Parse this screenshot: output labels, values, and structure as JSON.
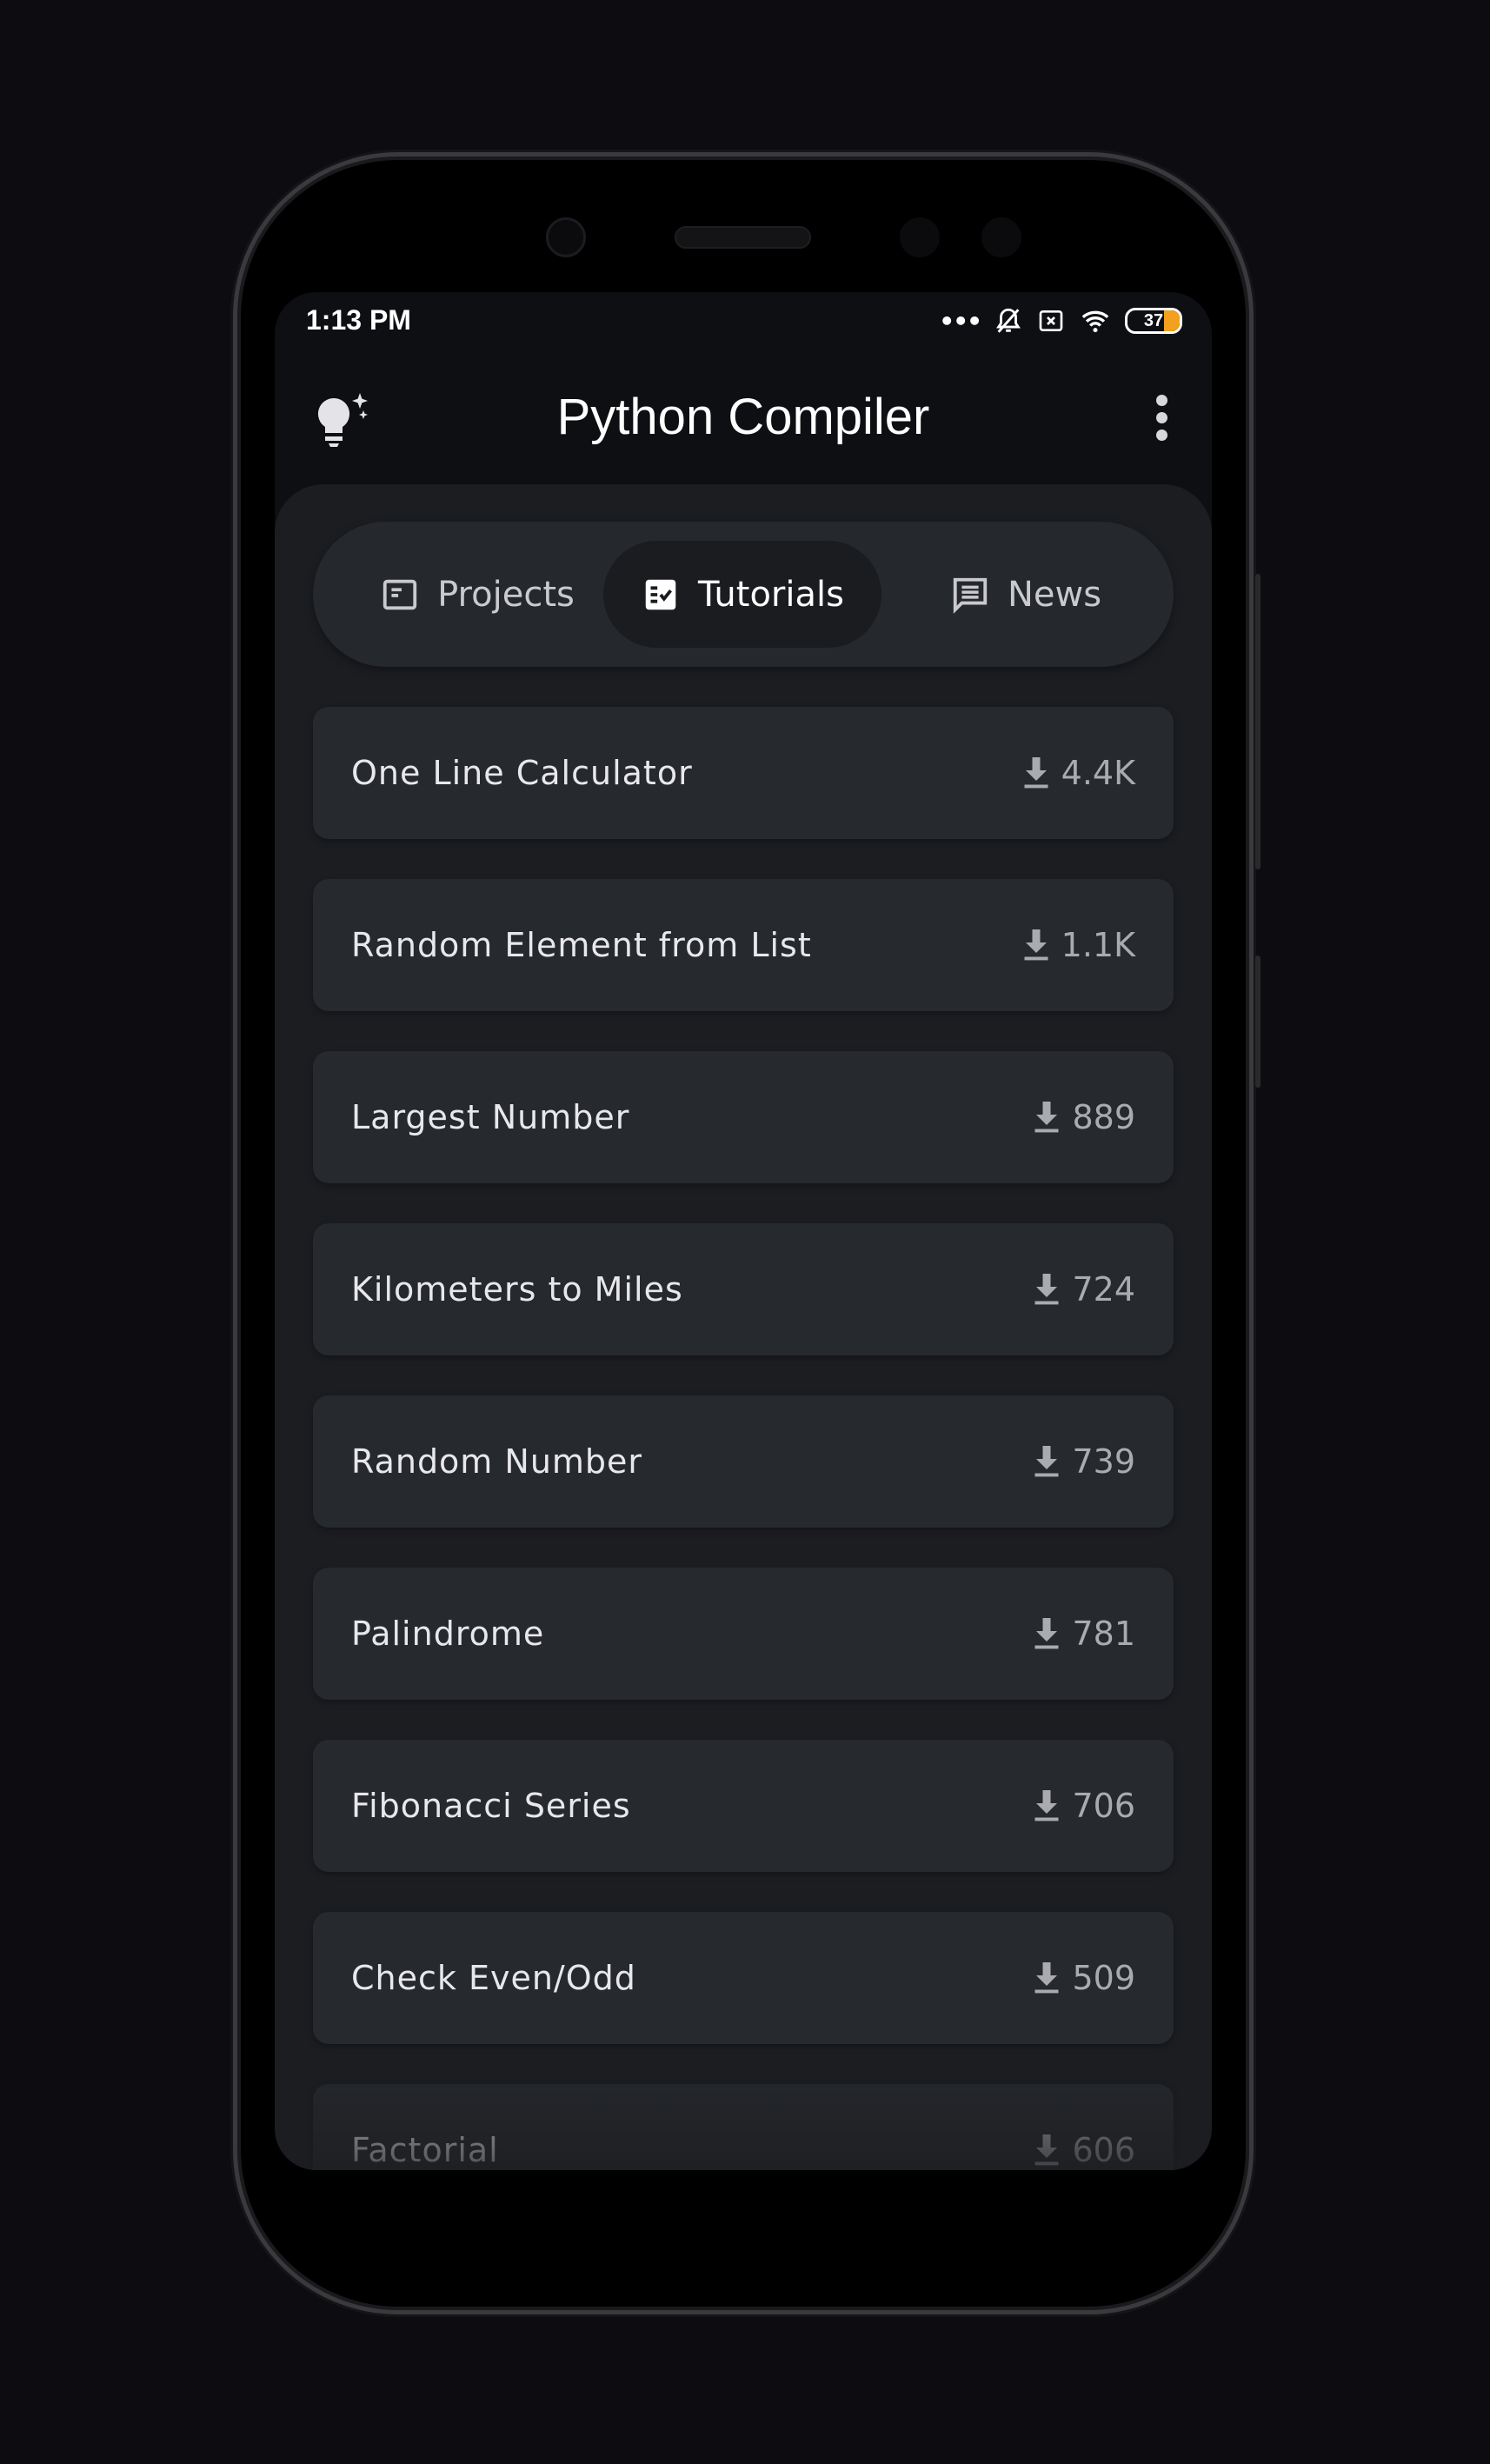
{
  "status_bar": {
    "time": "1:13 PM",
    "battery": "37",
    "icons": [
      "more-dots-icon",
      "bell-off-icon",
      "sim-x-icon",
      "wifi-icon",
      "battery-icon"
    ]
  },
  "app_bar": {
    "title": "Python Compiler",
    "left_icon": "lightbulb-sparkle-icon",
    "right_icon": "more-vert-icon"
  },
  "tabs": [
    {
      "label": "Projects",
      "icon": "article-icon",
      "active": false
    },
    {
      "label": "Tutorials",
      "icon": "checklist-icon",
      "active": true
    },
    {
      "label": "News",
      "icon": "chat-icon",
      "active": false
    }
  ],
  "tutorials": [
    {
      "name": "One Line Calculator",
      "downloads": "4.4K"
    },
    {
      "name": "Random Element from List",
      "downloads": "1.1K"
    },
    {
      "name": "Largest Number",
      "downloads": "889"
    },
    {
      "name": "Kilometers to Miles",
      "downloads": "724"
    },
    {
      "name": "Random Number",
      "downloads": "739"
    },
    {
      "name": "Palindrome",
      "downloads": "781"
    },
    {
      "name": "Fibonacci Series",
      "downloads": "706"
    },
    {
      "name": "Check Even/Odd",
      "downloads": "509"
    },
    {
      "name": "Factorial",
      "downloads": "606"
    }
  ],
  "colors": {
    "accent_battery": "#f2a01e",
    "panel": "#1c1d21",
    "card": "#26292d"
  }
}
